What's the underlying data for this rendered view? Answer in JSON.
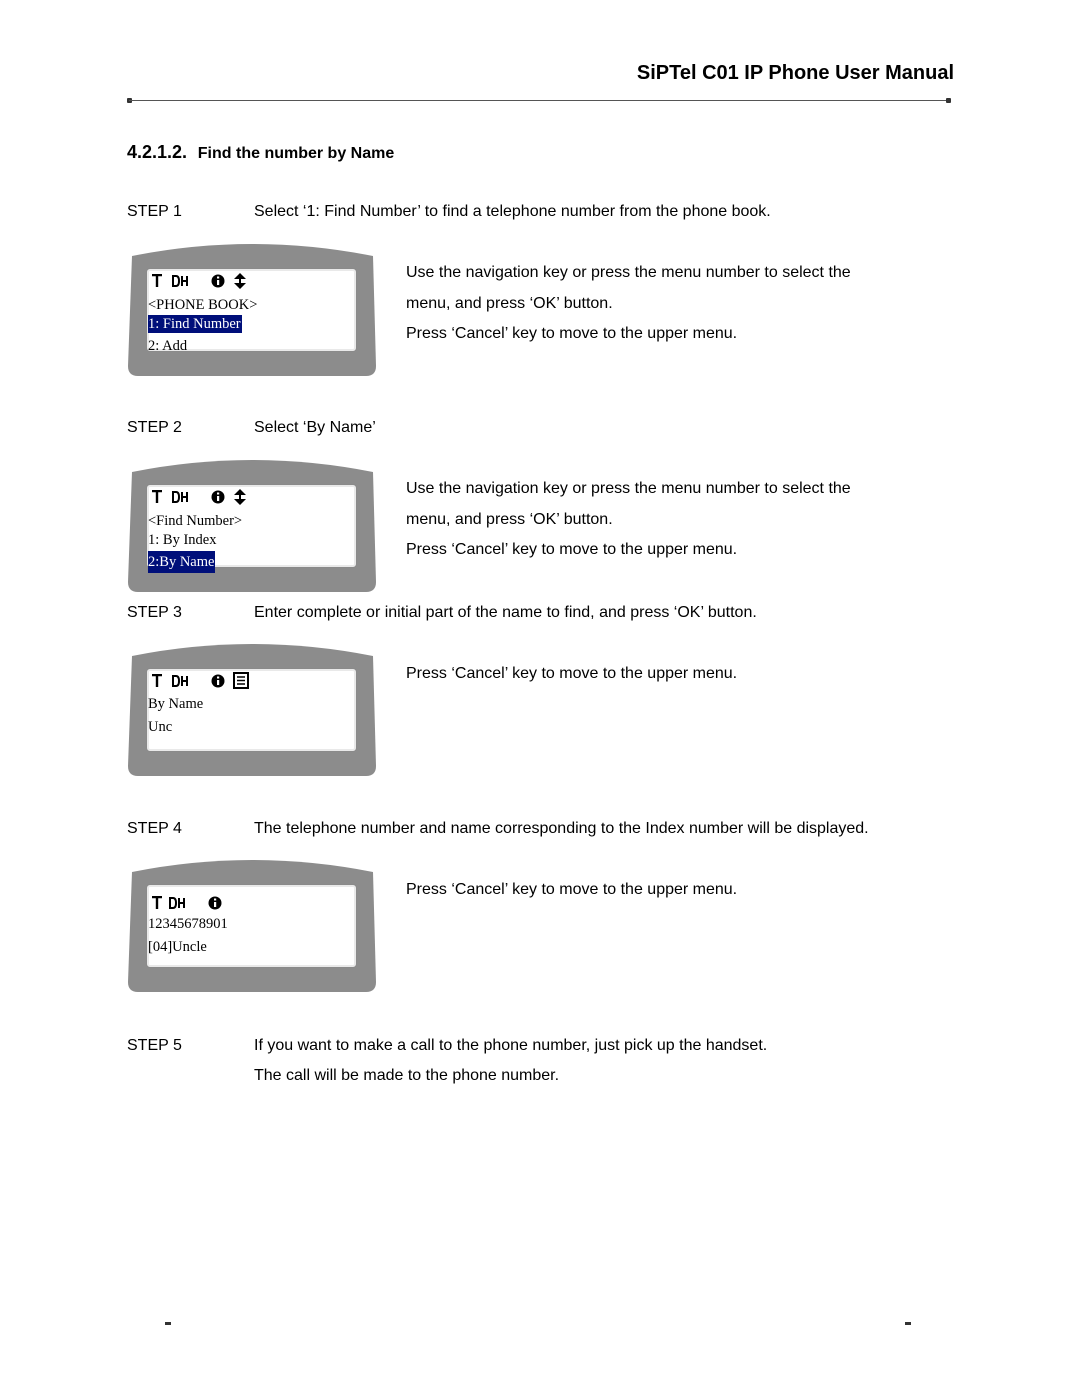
{
  "header": {
    "title": "SiPTel C01 IP Phone User Manual"
  },
  "section": {
    "number": "4.2.1.2.",
    "title": "Find the number by Name"
  },
  "colors": {
    "lcd_highlight": "#000f7a",
    "phone_frame": "#8c8c8c"
  },
  "steps": [
    {
      "label": "STEP 1",
      "text": "Select ‘1: Find Number’ to find a telephone number from the phone book.",
      "screen": {
        "icons": [
          "antenna-icon",
          "dh-icon",
          "info-icon",
          "updown-arrows-icon"
        ],
        "lines": [
          {
            "text": "<PHONE BOOK>",
            "selected": false
          },
          {
            "text": "1: Find Number",
            "selected": true
          },
          {
            "text": "2: Add",
            "selected": false
          }
        ]
      },
      "description": [
        "Use the navigation key or press the menu number to select the",
        "menu, and press ‘OK’ button.",
        "Press ‘Cancel’ key to move to the upper menu."
      ]
    },
    {
      "label": "STEP 2",
      "text": "Select ‘By Name’",
      "screen": {
        "icons": [
          "antenna-icon",
          "dh-icon",
          "info-icon",
          "updown-arrows-icon"
        ],
        "lines": [
          {
            "text": "<Find Number>",
            "selected": false
          },
          {
            "text": "1: By Index",
            "selected": false
          },
          {
            "text": "2:By Name",
            "selected": true
          }
        ]
      },
      "description": [
        "Use the navigation key or press the menu number to select the",
        "menu, and press ‘OK’ button.",
        "Press ‘Cancel’ key to move to the upper menu."
      ]
    },
    {
      "label": "STEP 3",
      "text": "Enter complete or initial part of the name to find, and press ‘OK’ button.",
      "screen": {
        "icons": [
          "antenna-icon",
          "dh-icon",
          "info-icon",
          "text-input-icon"
        ],
        "lines": [
          {
            "text": "By Name",
            "selected": false
          },
          {
            "text": "Unc",
            "selected": false
          }
        ]
      },
      "description": [
        "Press ‘Cancel’ key to move to the upper menu."
      ]
    },
    {
      "label": "STEP 4",
      "text": "The telephone number and name corresponding to the Index number will be displayed.",
      "screen": {
        "icons": [
          "antenna-icon",
          "dh-icon",
          "info-icon"
        ],
        "lines": [
          {
            "text": "12345678901",
            "selected": false
          },
          {
            "text": "[04]Uncle",
            "selected": false
          }
        ]
      },
      "description": [
        "Press ‘Cancel’ key to move to the upper menu."
      ]
    },
    {
      "label": "STEP 5",
      "text": "If you want to make a call to the phone number, just pick up the handset.",
      "text2": "The call will be made to the phone number."
    }
  ]
}
